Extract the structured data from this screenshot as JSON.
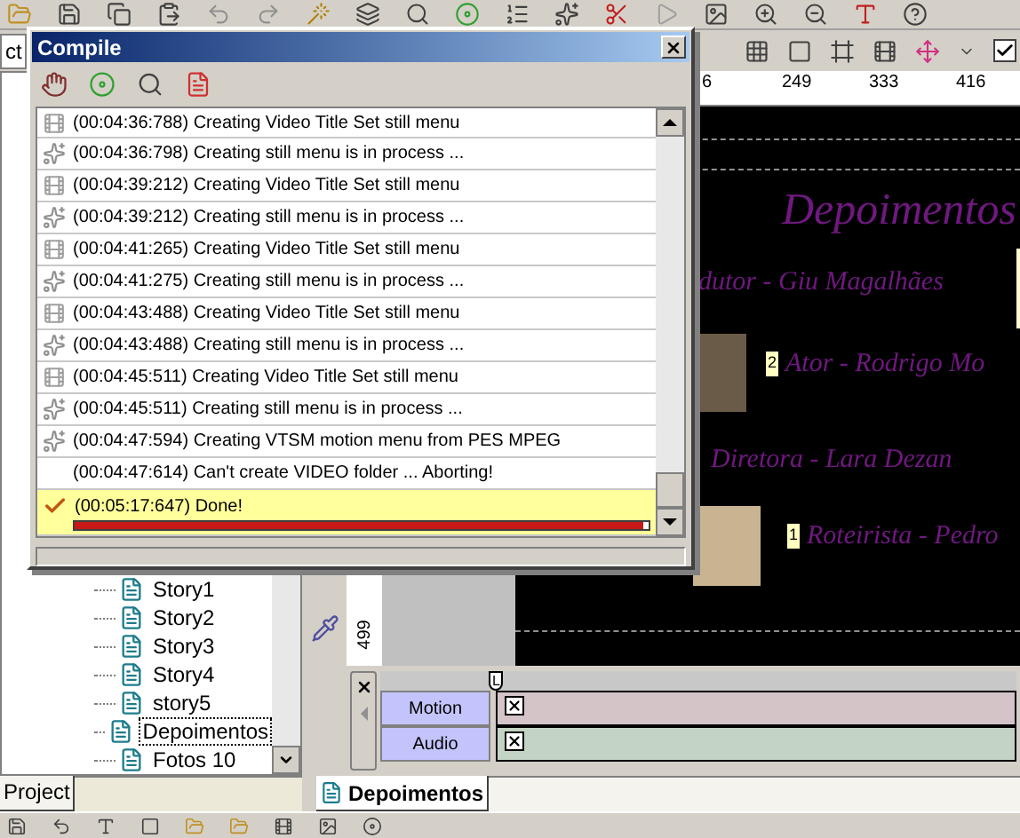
{
  "panel_tab_fragment": "ct",
  "toolbar_checkbox": {
    "checked": true
  },
  "compile_dialog": {
    "title": "Compile",
    "log": [
      {
        "kind": "video",
        "text": "(00:04:36:788) Creating Video Title Set still menu",
        "selected": false
      },
      {
        "kind": "process",
        "text": "(00:04:36:798) Creating still menu is in process ...",
        "selected": false
      },
      {
        "kind": "video",
        "text": "(00:04:39:212) Creating Video Title Set still menu",
        "selected": false
      },
      {
        "kind": "process",
        "text": "(00:04:39:212) Creating still menu is in process ...",
        "selected": false
      },
      {
        "kind": "video",
        "text": "(00:04:41:265) Creating Video Title Set still menu",
        "selected": false
      },
      {
        "kind": "process",
        "text": "(00:04:41:275) Creating still menu is in process ...",
        "selected": false
      },
      {
        "kind": "video",
        "text": "(00:04:43:488) Creating Video Title Set still menu",
        "selected": false
      },
      {
        "kind": "process",
        "text": "(00:04:43:488) Creating still menu is in process ...",
        "selected": false
      },
      {
        "kind": "video",
        "text": "(00:04:45:511) Creating Video Title Set still menu",
        "selected": false
      },
      {
        "kind": "process",
        "text": "(00:04:45:511) Creating still menu is in process ...",
        "selected": false
      },
      {
        "kind": "process",
        "text": "(00:04:47:594) Creating VTSM motion menu from PES MPEG",
        "selected": false
      },
      {
        "kind": "error",
        "text": "(00:04:47:614) Can't create VIDEO folder ... Aborting!",
        "selected": false
      },
      {
        "kind": "done",
        "text": "(00:05:17:647) Done!",
        "selected": true,
        "progress": {
          "level": 0.99
        }
      }
    ]
  },
  "project_tree": {
    "items": [
      {
        "label": "Story1",
        "selected": false
      },
      {
        "label": "Story2",
        "selected": false
      },
      {
        "label": "Story3",
        "selected": false
      },
      {
        "label": "Story4",
        "selected": false
      },
      {
        "label": "story5",
        "selected": false
      },
      {
        "label": "Depoimentos",
        "selected": true
      },
      {
        "label": "Fotos 10",
        "selected": false
      }
    ]
  },
  "ruler": {
    "labels": [
      "6",
      "249",
      "333",
      "416"
    ],
    "vertical_label": "499"
  },
  "menu_canvas": {
    "title": "Depoimentos",
    "entries": [
      {
        "text": "dutor - Giu Magalhães"
      },
      {
        "badge": "2",
        "text": "Ator - Rodrigo Mo"
      },
      {
        "text": "Diretora - Lara Dezan"
      },
      {
        "badge": "1",
        "text": "Roteirista - Pedro"
      }
    ]
  },
  "timeline": {
    "marker": "L",
    "tracks": [
      {
        "name": "Motion",
        "color": "#d4c4c8"
      },
      {
        "name": "Audio",
        "color": "#c4d4c4"
      }
    ]
  },
  "left_tabs": [
    {
      "label": "Project",
      "selected": true
    }
  ],
  "editor_tabs": [
    {
      "label": "Depoimentos",
      "selected": true
    }
  ]
}
